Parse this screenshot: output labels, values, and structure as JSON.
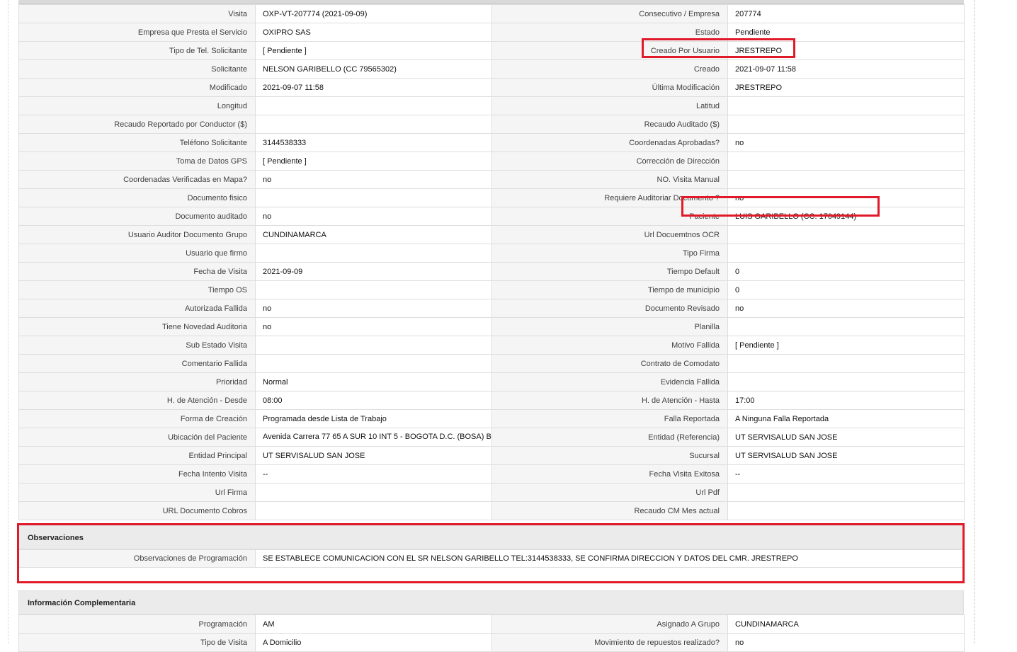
{
  "details": {
    "rows": [
      [
        {
          "label": "Visita",
          "value": "OXP-VT-207774 (2021-09-09)"
        },
        {
          "label": "Consecutivo / Empresa",
          "value": "207774"
        }
      ],
      [
        {
          "label": "Empresa que Presta el Servicio",
          "value": "OXIPRO SAS"
        },
        {
          "label": "Estado",
          "value": "Pendiente"
        }
      ],
      [
        {
          "label": "Tipo de Tel. Solicitante",
          "value": "[ Pendiente ]"
        },
        {
          "label": "Creado Por Usuario",
          "value": "JRESTREPO"
        }
      ],
      [
        {
          "label": "Solicitante",
          "value": "NELSON GARIBELLO (CC 79565302)"
        },
        {
          "label": "Creado",
          "value": "2021-09-07 11:58"
        }
      ],
      [
        {
          "label": "Modificado",
          "value": "2021-09-07 11:58"
        },
        {
          "label": "Última Modificación",
          "value": " JRESTREPO"
        }
      ],
      [
        {
          "label": "Longitud",
          "value": ""
        },
        {
          "label": "Latitud",
          "value": ""
        }
      ],
      [
        {
          "label": "Recaudo Reportado por Conductor ($)",
          "value": ""
        },
        {
          "label": "Recaudo Auditado ($)",
          "value": ""
        }
      ],
      [
        {
          "label": "Teléfono Solicitante",
          "value": "3144538333"
        },
        {
          "label": "Coordenadas Aprobadas?",
          "value": " no"
        }
      ],
      [
        {
          "label": "Toma de Datos GPS",
          "value": "[ Pendiente ]"
        },
        {
          "label": "Corrección de Dirección",
          "value": ""
        }
      ],
      [
        {
          "label": "Coordenadas Verificadas en Mapa?",
          "value": " no"
        },
        {
          "label": "NO. Visita Manual",
          "value": ""
        }
      ],
      [
        {
          "label": "Documento fisico",
          "value": ""
        },
        {
          "label": "Requiere Auditoriar Documento ?",
          "value": " no"
        }
      ],
      [
        {
          "label": "Documento auditado",
          "value": "no"
        },
        {
          "label": "Paciente",
          "value": "LUIS GARIBELLO (CC: 17049144)"
        }
      ],
      [
        {
          "label": "Usuario Auditor Documento Grupo",
          "value": "CUNDINAMARCA"
        },
        {
          "label": "Url Docuemtnos OCR",
          "value": ""
        }
      ],
      [
        {
          "label": "Usuario que firmo",
          "value": ""
        },
        {
          "label": "Tipo Firma",
          "value": ""
        }
      ],
      [
        {
          "label": "Fecha de Visita",
          "value": " 2021-09-09"
        },
        {
          "label": "Tiempo Default",
          "value": "0"
        }
      ],
      [
        {
          "label": "Tiempo OS",
          "value": ""
        },
        {
          "label": "Tiempo de municipio",
          "value": "0"
        }
      ],
      [
        {
          "label": "Autorizada Fallida",
          "value": " no"
        },
        {
          "label": "Documento Revisado",
          "value": " no"
        }
      ],
      [
        {
          "label": "Tiene Novedad Auditoria",
          "value": " no"
        },
        {
          "label": "Planilla",
          "value": ""
        }
      ],
      [
        {
          "label": "Sub Estado Visita",
          "value": ""
        },
        {
          "label": "Motivo Fallida",
          "value": "[ Pendiente ]"
        }
      ],
      [
        {
          "label": "Comentario Fallida",
          "value": ""
        },
        {
          "label": "Contrato de Comodato",
          "value": ""
        }
      ],
      [
        {
          "label": "Prioridad",
          "value": "Normal"
        },
        {
          "label": "Evidencia Fallida",
          "value": ""
        }
      ],
      [
        {
          "label": "H. de Atención - Desde",
          "value": "08:00"
        },
        {
          "label": "H. de Atención - Hasta",
          "value": "17:00"
        }
      ],
      [
        {
          "label": "Forma de Creación",
          "value": "Programada desde Lista de Trabajo"
        },
        {
          "label": "Falla Reportada",
          "value": "A Ninguna Falla Reportada"
        }
      ],
      [
        {
          "label": "Ubicación del Paciente",
          "value": "Avenida Carrera 77 65 A SUR 10 INT 5 - BOGOTA D.C. (BOSA) B"
        },
        {
          "label": "Entidad (Referencia)",
          "value": "UT SERVISALUD SAN JOSE"
        }
      ],
      [
        {
          "label": "Entidad Principal",
          "value": "UT SERVISALUD SAN JOSE"
        },
        {
          "label": "Sucursal",
          "value": "UT SERVISALUD SAN JOSE"
        }
      ],
      [
        {
          "label": "Fecha Intento Visita",
          "value": " --"
        },
        {
          "label": "Fecha Visita Exitosa",
          "value": " --"
        }
      ],
      [
        {
          "label": "Url Firma",
          "value": ""
        },
        {
          "label": "Url Pdf",
          "value": ""
        }
      ],
      [
        {
          "label": "URL Documento Cobros",
          "value": ""
        },
        {
          "label": "Recaudo CM Mes actual",
          "value": ""
        }
      ]
    ]
  },
  "observaciones": {
    "title": "Observaciones",
    "label": "Observaciones de Programación",
    "value": " SE ESTABLECE COMUNICACION CON EL SR NELSON GARIBELLO TEL:3144538333, SE CONFIRMA DIRECCION Y DATOS DEL CMR. JRESTREPO"
  },
  "info_complementaria": {
    "title": "Información Complementaria",
    "rows": [
      [
        {
          "label": "Programación",
          "value": "AM"
        },
        {
          "label": "Asignado A Grupo",
          "value": "CUNDINAMARCA"
        }
      ],
      [
        {
          "label": "Tipo de Visita",
          "value": "A Domicilio"
        },
        {
          "label": "Movimiento de repuestos realizado?",
          "value": " no"
        }
      ]
    ]
  },
  "highlight_color": "#e11a2a"
}
